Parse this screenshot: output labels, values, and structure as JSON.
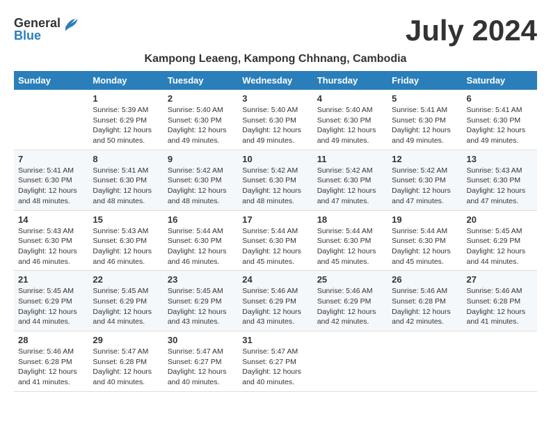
{
  "header": {
    "logo_general": "General",
    "logo_blue": "Blue",
    "month_title": "July 2024",
    "subtitle": "Kampong Leaeng, Kampong Chhnang, Cambodia"
  },
  "weekdays": [
    "Sunday",
    "Monday",
    "Tuesday",
    "Wednesday",
    "Thursday",
    "Friday",
    "Saturday"
  ],
  "weeks": [
    [
      {
        "day": "",
        "info": ""
      },
      {
        "day": "1",
        "info": "Sunrise: 5:39 AM\nSunset: 6:29 PM\nDaylight: 12 hours\nand 50 minutes."
      },
      {
        "day": "2",
        "info": "Sunrise: 5:40 AM\nSunset: 6:30 PM\nDaylight: 12 hours\nand 49 minutes."
      },
      {
        "day": "3",
        "info": "Sunrise: 5:40 AM\nSunset: 6:30 PM\nDaylight: 12 hours\nand 49 minutes."
      },
      {
        "day": "4",
        "info": "Sunrise: 5:40 AM\nSunset: 6:30 PM\nDaylight: 12 hours\nand 49 minutes."
      },
      {
        "day": "5",
        "info": "Sunrise: 5:41 AM\nSunset: 6:30 PM\nDaylight: 12 hours\nand 49 minutes."
      },
      {
        "day": "6",
        "info": "Sunrise: 5:41 AM\nSunset: 6:30 PM\nDaylight: 12 hours\nand 49 minutes."
      }
    ],
    [
      {
        "day": "7",
        "info": "Sunrise: 5:41 AM\nSunset: 6:30 PM\nDaylight: 12 hours\nand 48 minutes."
      },
      {
        "day": "8",
        "info": "Sunrise: 5:41 AM\nSunset: 6:30 PM\nDaylight: 12 hours\nand 48 minutes."
      },
      {
        "day": "9",
        "info": "Sunrise: 5:42 AM\nSunset: 6:30 PM\nDaylight: 12 hours\nand 48 minutes."
      },
      {
        "day": "10",
        "info": "Sunrise: 5:42 AM\nSunset: 6:30 PM\nDaylight: 12 hours\nand 48 minutes."
      },
      {
        "day": "11",
        "info": "Sunrise: 5:42 AM\nSunset: 6:30 PM\nDaylight: 12 hours\nand 47 minutes."
      },
      {
        "day": "12",
        "info": "Sunrise: 5:42 AM\nSunset: 6:30 PM\nDaylight: 12 hours\nand 47 minutes."
      },
      {
        "day": "13",
        "info": "Sunrise: 5:43 AM\nSunset: 6:30 PM\nDaylight: 12 hours\nand 47 minutes."
      }
    ],
    [
      {
        "day": "14",
        "info": "Sunrise: 5:43 AM\nSunset: 6:30 PM\nDaylight: 12 hours\nand 46 minutes."
      },
      {
        "day": "15",
        "info": "Sunrise: 5:43 AM\nSunset: 6:30 PM\nDaylight: 12 hours\nand 46 minutes."
      },
      {
        "day": "16",
        "info": "Sunrise: 5:44 AM\nSunset: 6:30 PM\nDaylight: 12 hours\nand 46 minutes."
      },
      {
        "day": "17",
        "info": "Sunrise: 5:44 AM\nSunset: 6:30 PM\nDaylight: 12 hours\nand 45 minutes."
      },
      {
        "day": "18",
        "info": "Sunrise: 5:44 AM\nSunset: 6:30 PM\nDaylight: 12 hours\nand 45 minutes."
      },
      {
        "day": "19",
        "info": "Sunrise: 5:44 AM\nSunset: 6:30 PM\nDaylight: 12 hours\nand 45 minutes."
      },
      {
        "day": "20",
        "info": "Sunrise: 5:45 AM\nSunset: 6:29 PM\nDaylight: 12 hours\nand 44 minutes."
      }
    ],
    [
      {
        "day": "21",
        "info": "Sunrise: 5:45 AM\nSunset: 6:29 PM\nDaylight: 12 hours\nand 44 minutes."
      },
      {
        "day": "22",
        "info": "Sunrise: 5:45 AM\nSunset: 6:29 PM\nDaylight: 12 hours\nand 44 minutes."
      },
      {
        "day": "23",
        "info": "Sunrise: 5:45 AM\nSunset: 6:29 PM\nDaylight: 12 hours\nand 43 minutes."
      },
      {
        "day": "24",
        "info": "Sunrise: 5:46 AM\nSunset: 6:29 PM\nDaylight: 12 hours\nand 43 minutes."
      },
      {
        "day": "25",
        "info": "Sunrise: 5:46 AM\nSunset: 6:29 PM\nDaylight: 12 hours\nand 42 minutes."
      },
      {
        "day": "26",
        "info": "Sunrise: 5:46 AM\nSunset: 6:28 PM\nDaylight: 12 hours\nand 42 minutes."
      },
      {
        "day": "27",
        "info": "Sunrise: 5:46 AM\nSunset: 6:28 PM\nDaylight: 12 hours\nand 41 minutes."
      }
    ],
    [
      {
        "day": "28",
        "info": "Sunrise: 5:46 AM\nSunset: 6:28 PM\nDaylight: 12 hours\nand 41 minutes."
      },
      {
        "day": "29",
        "info": "Sunrise: 5:47 AM\nSunset: 6:28 PM\nDaylight: 12 hours\nand 40 minutes."
      },
      {
        "day": "30",
        "info": "Sunrise: 5:47 AM\nSunset: 6:27 PM\nDaylight: 12 hours\nand 40 minutes."
      },
      {
        "day": "31",
        "info": "Sunrise: 5:47 AM\nSunset: 6:27 PM\nDaylight: 12 hours\nand 40 minutes."
      },
      {
        "day": "",
        "info": ""
      },
      {
        "day": "",
        "info": ""
      },
      {
        "day": "",
        "info": ""
      }
    ]
  ]
}
